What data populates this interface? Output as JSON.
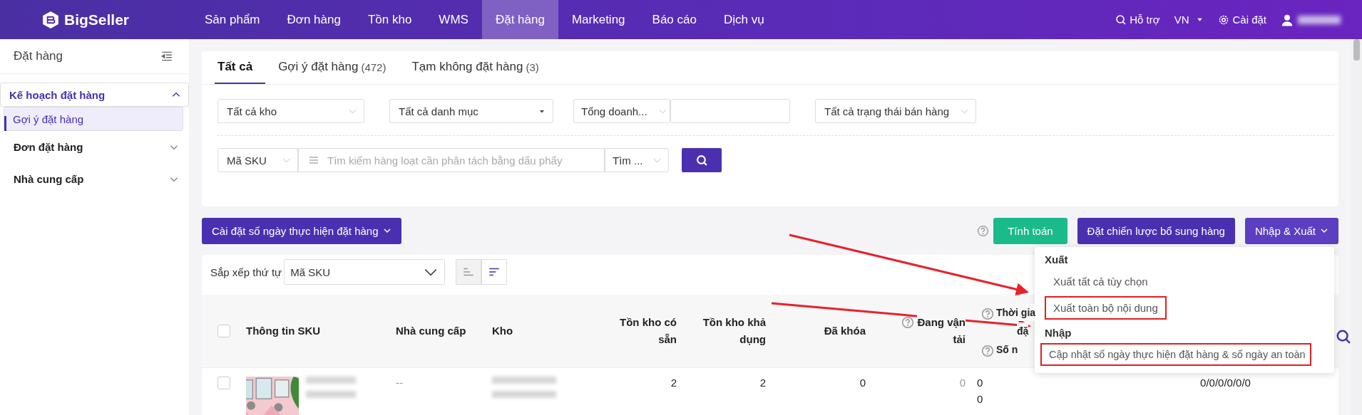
{
  "topbar": {
    "logo": "BigSeller",
    "nav": [
      {
        "label": "Sản phẩm",
        "selected": false
      },
      {
        "label": "Đơn hàng",
        "selected": false
      },
      {
        "label": "Tồn kho",
        "selected": false
      },
      {
        "label": "WMS",
        "selected": false
      },
      {
        "label": "Đặt hàng",
        "selected": true
      },
      {
        "label": "Marketing",
        "selected": false
      },
      {
        "label": "Báo cáo",
        "selected": false
      },
      {
        "label": "Dịch vụ",
        "selected": false
      }
    ],
    "help": "Hỗ trợ",
    "language": "VN",
    "settings": "Cài đặt"
  },
  "sidebar": {
    "title": "Đặt hàng",
    "groups": [
      {
        "label": "Kế hoạch đặt hàng",
        "expanded": true,
        "selected": true,
        "children": [
          {
            "label": "Gợi ý đặt hàng",
            "selected": true
          }
        ]
      },
      {
        "label": "Đơn đặt hàng",
        "expanded": false,
        "selected": false
      },
      {
        "label": "Nhà cung cấp",
        "expanded": false,
        "selected": false
      }
    ]
  },
  "tabs": [
    {
      "label": "Tất cả",
      "selected": true
    },
    {
      "label": "Gợi ý đặt hàng",
      "count": "(472)",
      "selected": false
    },
    {
      "label": "Tạm không đặt hàng",
      "count": "(3)",
      "selected": false
    }
  ],
  "filters": {
    "warehouse": "Tất cả kho",
    "category": "Tất cả danh mục",
    "metric": "Tổng doanh...",
    "status": "Tất cả trạng thái bán hàng",
    "search_type": "Mã SKU",
    "search_placeholder": "Tìm kiếm hàng loạt cần phân tách bằng dấu phẩy",
    "match": "Tìm ..."
  },
  "toolbar": {
    "days_button": "Cài đặt số ngày thực hiện đặt hàng",
    "calc_button": "Tính toán",
    "strategy_button": "Đặt chiến lược bổ sung hàng",
    "import_export_button": "Nhập & Xuất"
  },
  "menu": {
    "expanded": true,
    "sections": [
      {
        "title": "Xuất",
        "items": [
          {
            "label": "Xuất tất cả tùy chọn",
            "highlighted": false
          },
          {
            "label": "Xuất toàn bộ nội dung",
            "highlighted": true
          }
        ]
      },
      {
        "title": "Nhập",
        "items": [
          {
            "label": "Cập nhật số ngày thực hiện đặt hàng & số ngày an toàn",
            "highlighted": true
          }
        ]
      }
    ]
  },
  "sort": {
    "label": "Sắp xếp thứ tự",
    "value": "Mã SKU",
    "orders": [
      {
        "kind": "asc",
        "selected": false
      },
      {
        "kind": "desc",
        "selected": true
      }
    ]
  },
  "table": {
    "select_all_checked": false,
    "columns": [
      {
        "lines": [
          "Thông tin SKU"
        ],
        "help": false
      },
      {
        "lines": [
          "Nhà cung cấp"
        ],
        "help": false
      },
      {
        "lines": [
          "Kho"
        ],
        "help": false
      },
      {
        "lines": [
          "Tồn kho có",
          "sẵn"
        ],
        "help": false
      },
      {
        "lines": [
          "Tồn kho khả",
          "dụng"
        ],
        "help": false
      },
      {
        "lines": [
          "Đã khóa"
        ],
        "help": false
      },
      {
        "lines": [
          "Đang vận",
          "tải"
        ],
        "help": true
      }
    ],
    "partial_column": {
      "line_1": "Thời gia",
      "line_2": "đặ",
      "line_3": "Số n"
    },
    "rows": [
      {
        "checked": false,
        "supplier": "--",
        "stock": "2",
        "available": "2",
        "locked": "0",
        "in_transit": "0",
        "time": [
          "0",
          "0"
        ],
        "last": "0/0/0/0/0/0"
      }
    ]
  }
}
